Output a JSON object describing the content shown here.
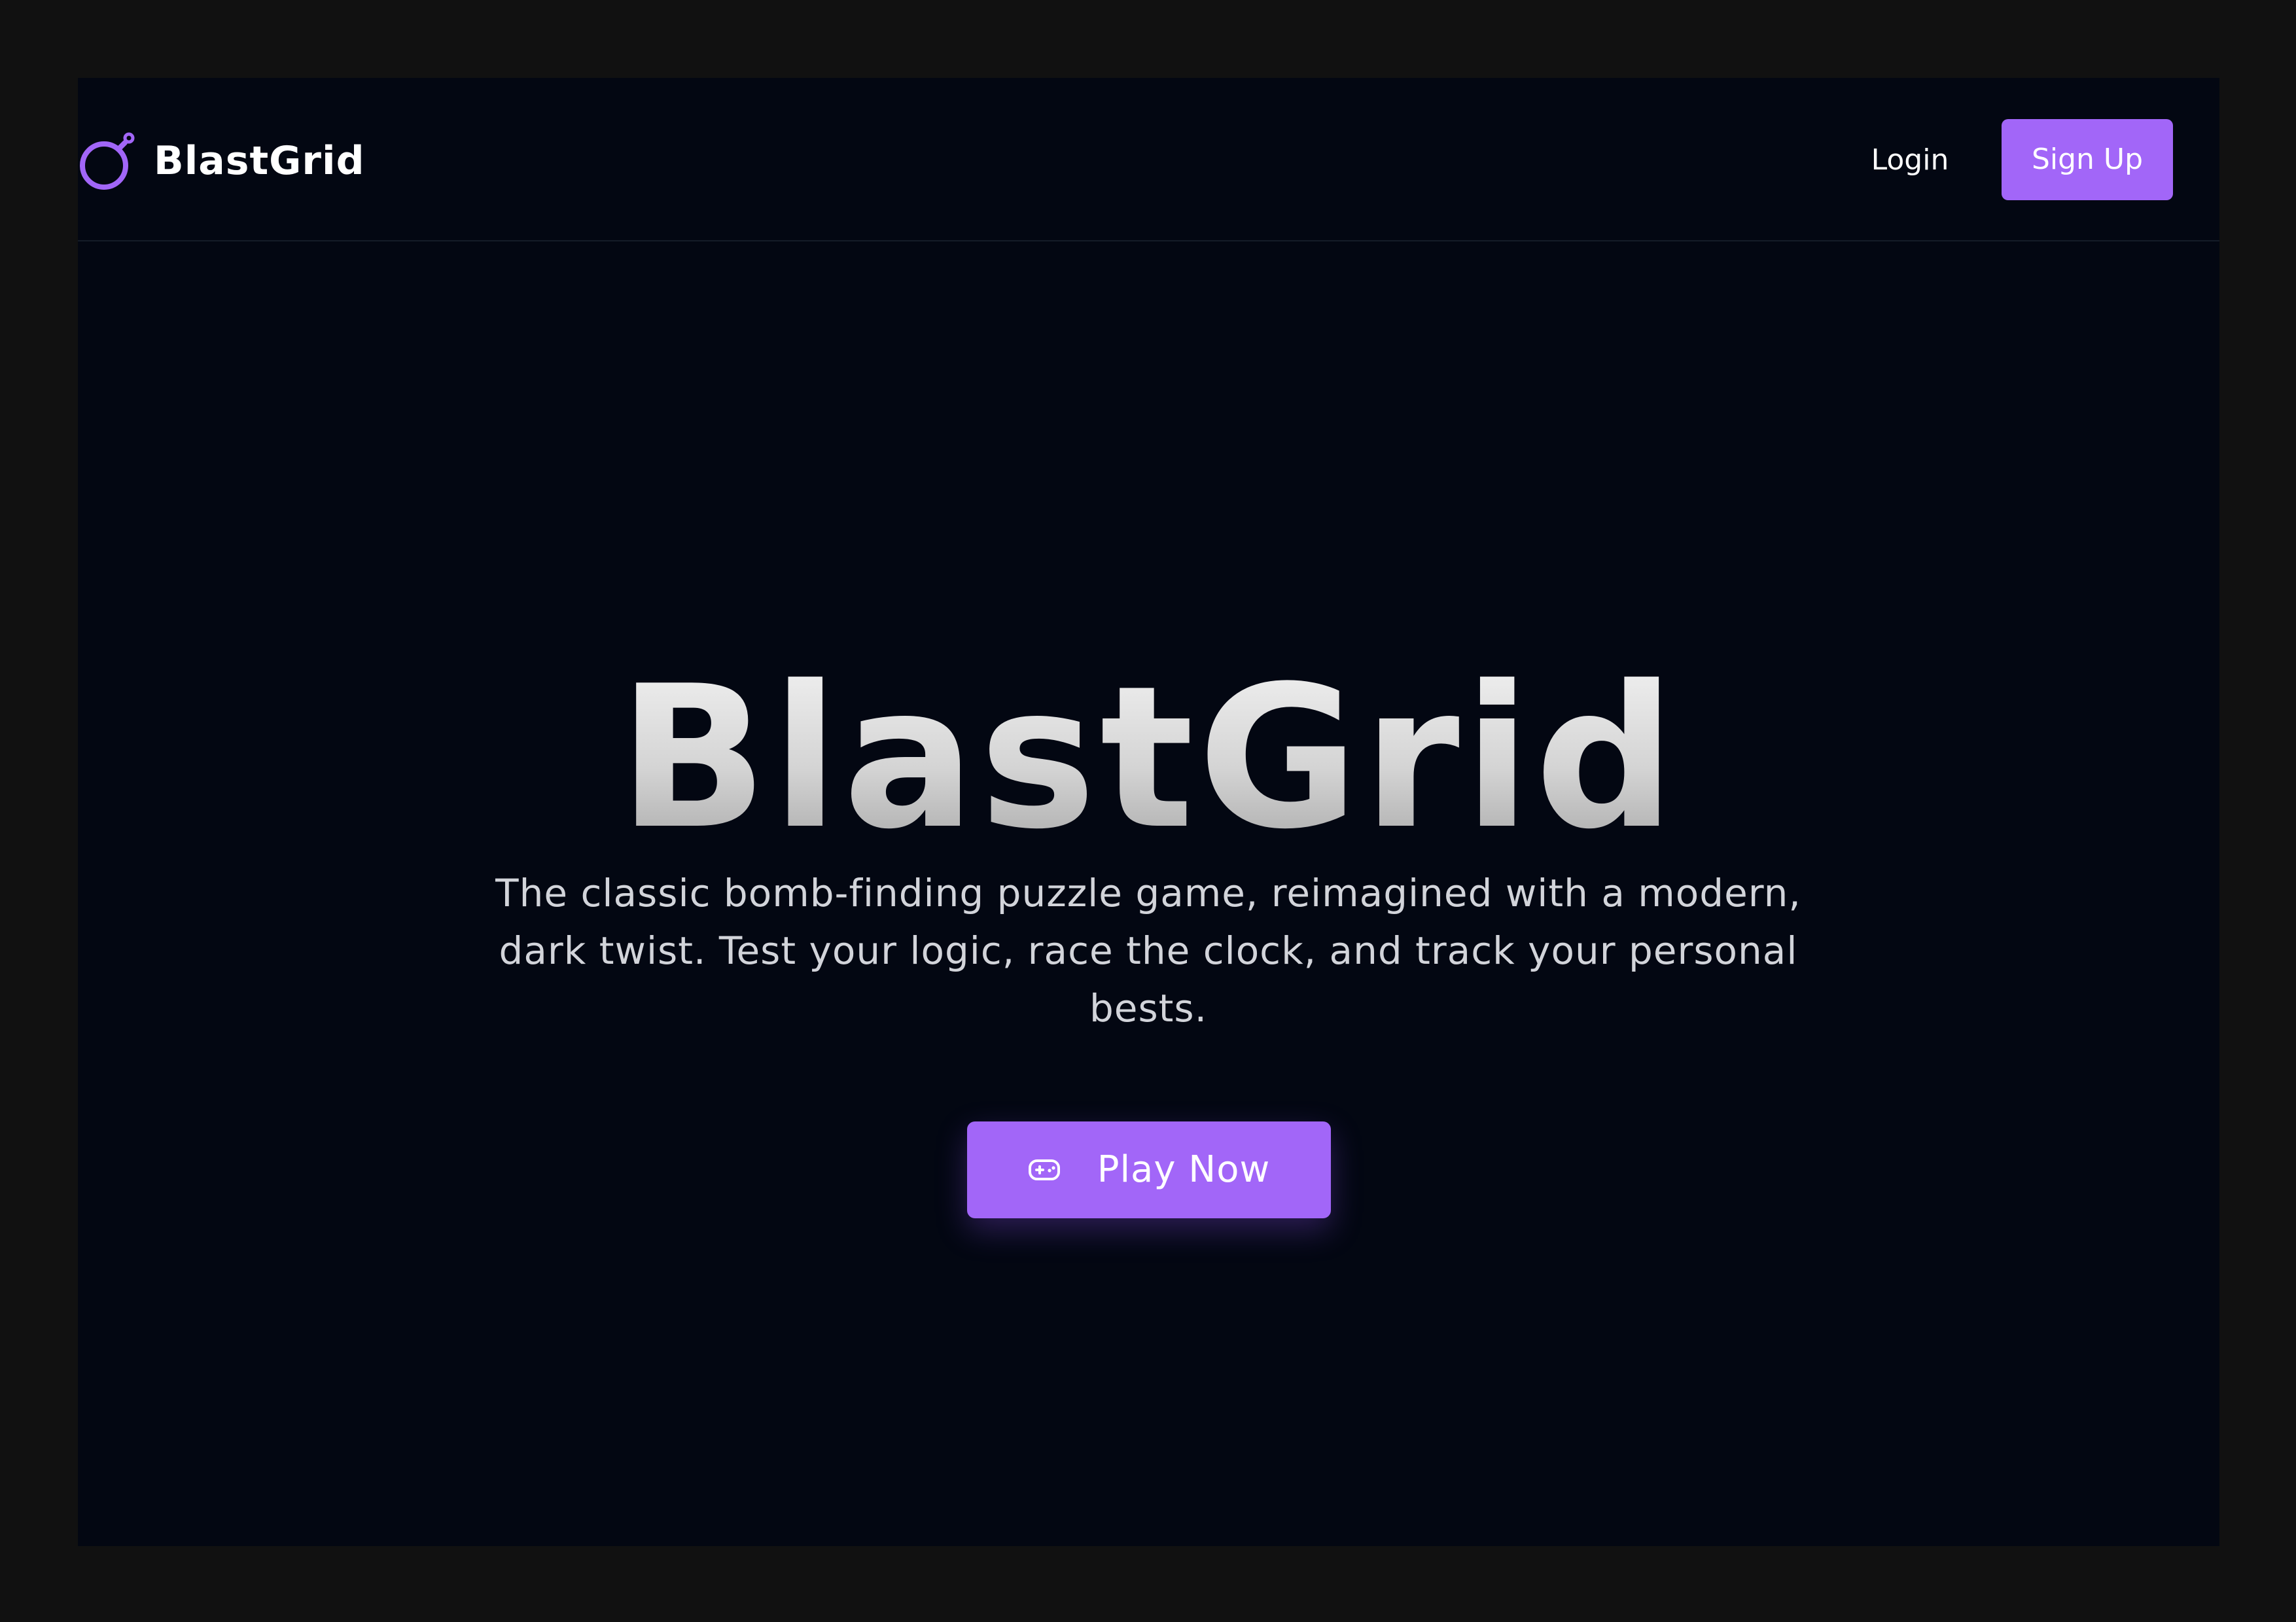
{
  "colors": {
    "outer_background": "#111111",
    "page_background": "#030712",
    "accent": "#a266f8",
    "text_primary": "#ffffff",
    "text_secondary": "#d2d4da"
  },
  "header": {
    "brand_icon": "bomb-icon",
    "brand_name": "BlastGrid",
    "login_label": "Login",
    "signup_label": "Sign Up"
  },
  "hero": {
    "title": "BlastGrid",
    "subtitle": "The classic bomb-finding puzzle game, reimagined with a modern, dark twist. Test your logic, race the clock, and track your personal bests.",
    "cta_icon": "gamepad-icon",
    "cta_label": "Play Now"
  }
}
